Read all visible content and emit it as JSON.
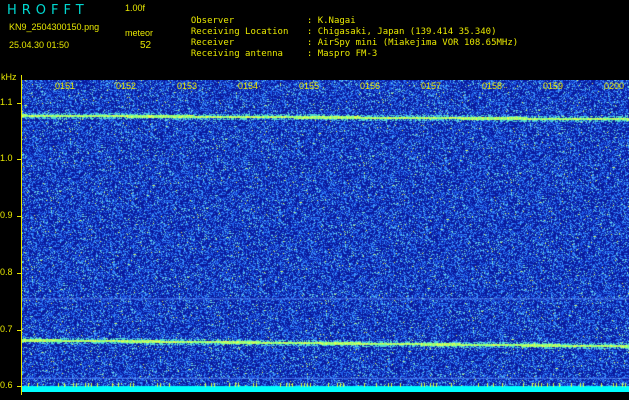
{
  "app": {
    "title": "HROFFT",
    "version": "1.00f"
  },
  "file_name": "KN9_2504300150.png",
  "timestamp": "25.04.30 01:50",
  "meteor": {
    "label": "meteor",
    "count": "52"
  },
  "station": {
    "observer": {
      "label": "Observer",
      "value": "K.Nagai"
    },
    "location": {
      "label": "Receiving Location",
      "value": "Chigasaki, Japan (139.414 35.340)"
    },
    "receiver": {
      "label": "Receiver",
      "value": "AirSpy mini (Miakejima VOR 108.65MHz)"
    },
    "antenna": {
      "label": "Receiving antenna",
      "value": "Maspro FM-3"
    }
  },
  "spectrogram": {
    "frequency_unit": "kHz",
    "frequency_labels": [
      "1.1",
      "1.0",
      "0.9",
      "0.8",
      "0.7",
      "0.6"
    ],
    "frequency_ticks": [
      1.1,
      1.0,
      0.9,
      0.8,
      0.7,
      0.6
    ],
    "freq_range_khz": [
      0.59,
      1.14
    ],
    "time_labels": [
      "0151",
      "0152",
      "0153",
      "0154",
      "0155",
      "0156",
      "0157",
      "0158",
      "0159",
      "0200"
    ],
    "colors": {
      "background": "#0a1a9e",
      "noise": "#3a8cff",
      "strong": "#7fffd0",
      "peak": "#e8ff40",
      "bottom_band": "#00ffff"
    }
  }
}
